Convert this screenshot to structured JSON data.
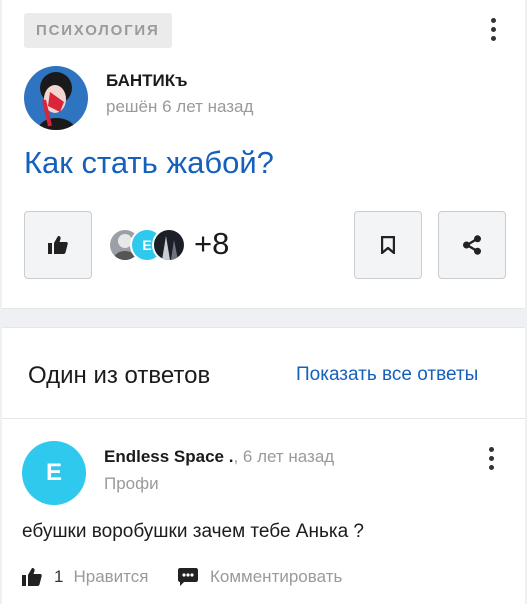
{
  "question": {
    "category": "ПСИХОЛОГИЯ",
    "author": "БАНТИКъ",
    "time": "решён 6 лет назад",
    "title": "Как стать жабой?",
    "likers_avatar_letter": "E",
    "likes_more": "+8"
  },
  "answers": {
    "section_title": "Один из ответов",
    "show_all": "Показать все ответы",
    "item": {
      "avatar_letter": "E",
      "author": "Endless Space .",
      "time": ", 6 лет назад",
      "role": "Профи",
      "text": "ебушки воробушки зачем тебе Анька ?",
      "like_count": "1",
      "like_label": "Нравится",
      "comment_label": "Комментировать"
    }
  },
  "colors": {
    "link": "#1560bd",
    "muted": "#9a9a9a",
    "answer_avatar": "#2ec9ec"
  },
  "icons": [
    "more-vertical-icon",
    "thumbs-up-icon",
    "bookmark-icon",
    "share-icon",
    "comment-icon"
  ]
}
